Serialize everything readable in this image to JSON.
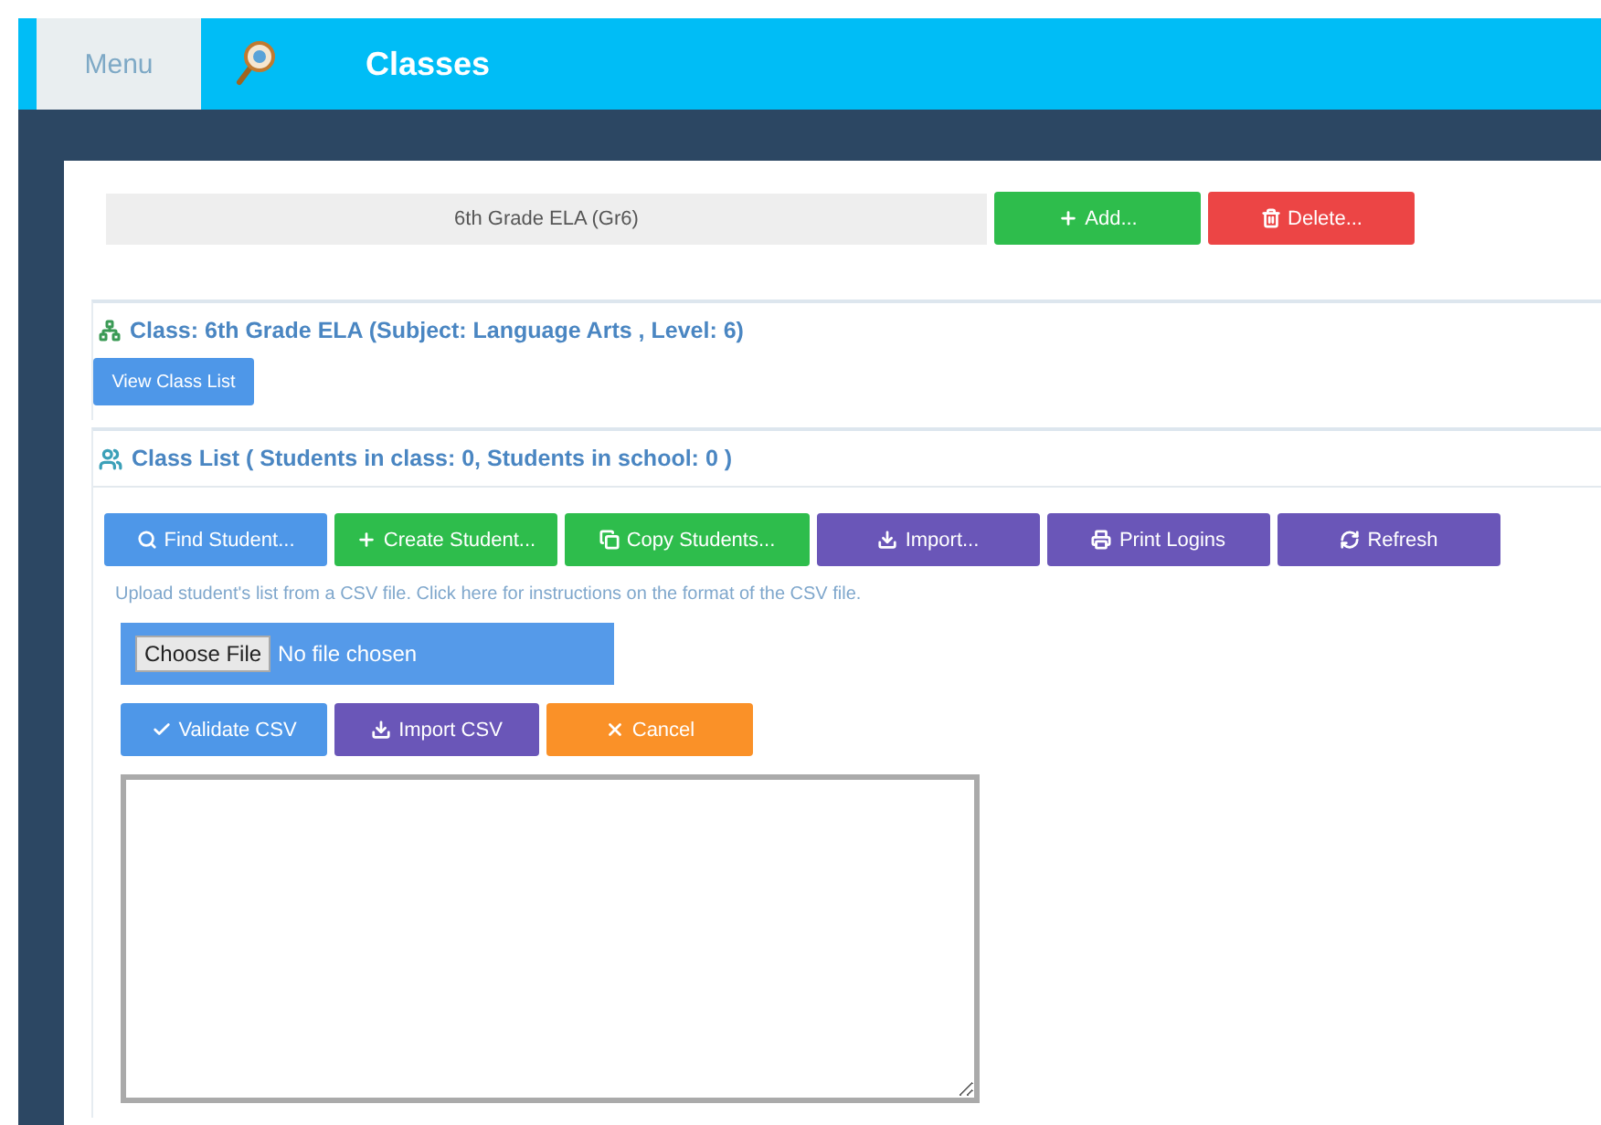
{
  "top_bar": {
    "menu": "Menu",
    "title": "Classes"
  },
  "class_selector": {
    "value": "6th Grade ELA (Gr6)"
  },
  "class_actions": [
    {
      "label": "Add...",
      "kind": "success"
    },
    {
      "label": "Delete...",
      "kind": "danger"
    }
  ],
  "class_panel": {
    "title": "Class: 6th Grade ELA (Subject: Language Arts , Level: 6)",
    "button": "View Class List"
  },
  "class_list_panel": {
    "title": "Class List ( Students in class: 0, Students in school: 0 )",
    "toolbar": [
      {
        "label": "Find Student...",
        "kind": "primary"
      },
      {
        "label": "Create Student...",
        "kind": "success"
      },
      {
        "label": "Copy Students...",
        "kind": "success"
      },
      {
        "label": "Import...",
        "kind": "purple"
      },
      {
        "label": "Print Logins",
        "kind": "purple"
      },
      {
        "label": "Refresh",
        "kind": "purple"
      }
    ],
    "help_text": "Upload student's list from a CSV file. Click here for instructions on the format of the CSV file.",
    "file_input": {
      "button": "Choose File",
      "status": "No file chosen"
    },
    "csv_actions": [
      {
        "label": "Validate CSV",
        "kind": "primary"
      },
      {
        "label": "Import CSV",
        "kind": "purple"
      },
      {
        "label": "Cancel",
        "kind": "warning"
      }
    ]
  }
}
